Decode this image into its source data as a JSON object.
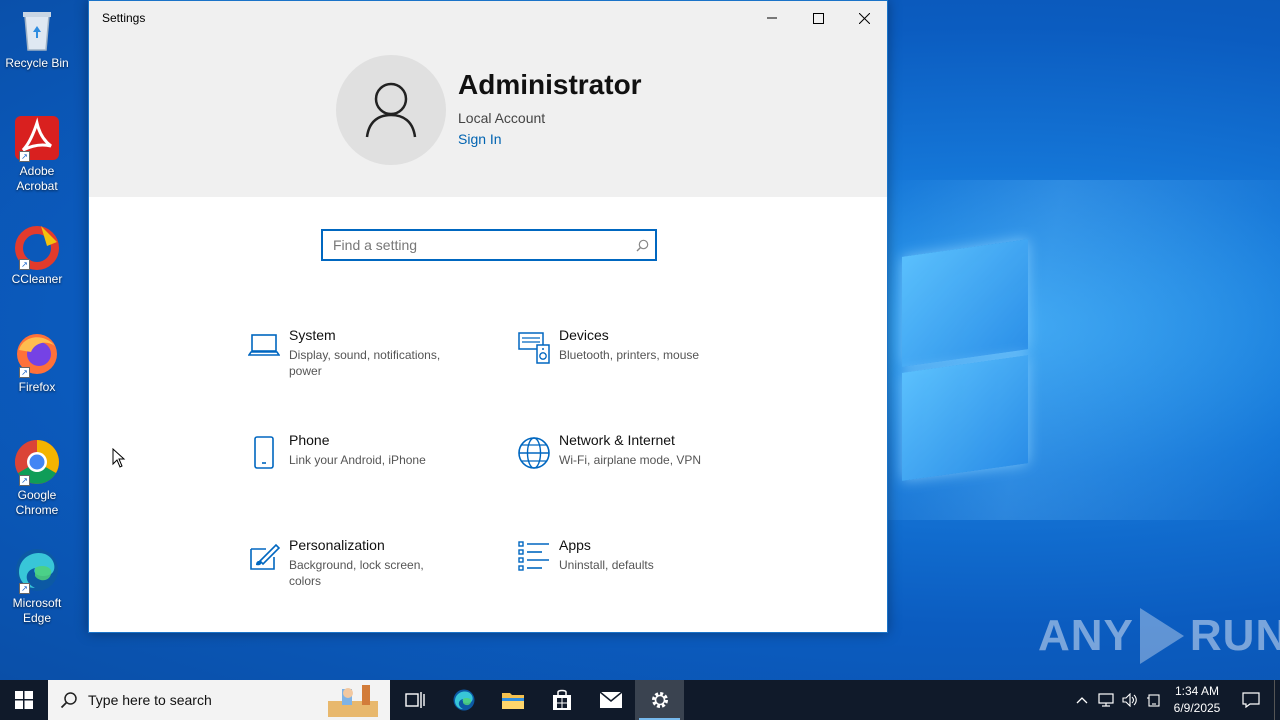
{
  "desktop": {
    "icons": [
      {
        "label": "Recycle Bin"
      },
      {
        "label": "Adobe Acrobat"
      },
      {
        "label": "CCleaner"
      },
      {
        "label": "Firefox"
      },
      {
        "label": "Google Chrome"
      },
      {
        "label": "Microsoft Edge"
      }
    ],
    "watermark": "ANY RUN"
  },
  "window": {
    "title": "Settings",
    "account": {
      "name": "Administrator",
      "type": "Local Account",
      "sign_in": "Sign In"
    },
    "search": {
      "placeholder": "Find a setting",
      "value": ""
    },
    "categories": [
      {
        "title": "System",
        "desc": "Display, sound, notifications, power",
        "icon": "laptop-icon"
      },
      {
        "title": "Devices",
        "desc": "Bluetooth, printers, mouse",
        "icon": "devices-icon"
      },
      {
        "title": "Phone",
        "desc": "Link your Android, iPhone",
        "icon": "phone-icon"
      },
      {
        "title": "Network & Internet",
        "desc": "Wi-Fi, airplane mode, VPN",
        "icon": "globe-icon"
      },
      {
        "title": "Personalization",
        "desc": "Background, lock screen, colors",
        "icon": "paintbrush-icon"
      },
      {
        "title": "Apps",
        "desc": "Uninstall, defaults",
        "icon": "apps-list-icon"
      }
    ]
  },
  "taskbar": {
    "search_label": "Type here to search",
    "clock": {
      "time": "1:34 AM",
      "date": "6/9/2025"
    }
  },
  "colors": {
    "accent": "#0067c0",
    "link": "#0063b1",
    "taskbar": "#101a2a"
  }
}
